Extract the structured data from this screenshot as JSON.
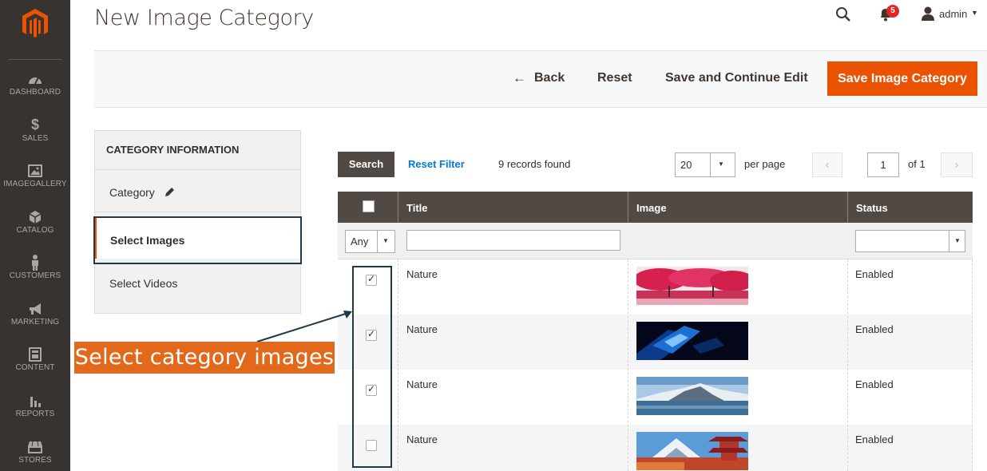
{
  "sidebar": {
    "logo": "magento-logo",
    "items": [
      {
        "label": "DASHBOARD",
        "icon": "speedometer-icon"
      },
      {
        "label": "SALES",
        "icon": "dollar-icon"
      },
      {
        "label": "IMAGEGALLERY",
        "icon": "image-icon"
      },
      {
        "label": "CATALOG",
        "icon": "cube-icon"
      },
      {
        "label": "CUSTOMERS",
        "icon": "person-icon"
      },
      {
        "label": "MARKETING",
        "icon": "megaphone-icon"
      },
      {
        "label": "CONTENT",
        "icon": "layout-icon"
      },
      {
        "label": "REPORTS",
        "icon": "bar-chart-icon"
      },
      {
        "label": "STORES",
        "icon": "store-icon"
      }
    ]
  },
  "header": {
    "title": "New Image Category",
    "notifications_count": "5",
    "user": "admin"
  },
  "actions": {
    "back_arrow": "←",
    "back": "Back",
    "reset": "Reset",
    "save_continue": "Save and Continue Edit",
    "save": "Save Image Category"
  },
  "panel": {
    "heading": "CATEGORY INFORMATION",
    "tabs": [
      {
        "label": "Category"
      },
      {
        "label": "Select Images"
      },
      {
        "label": "Select Videos"
      }
    ]
  },
  "grid": {
    "search_label": "Search",
    "reset_filter": "Reset Filter",
    "records": "9 records found",
    "per_page_value": "20",
    "per_page_label": "per page",
    "page_value": "1",
    "page_of": "of 1",
    "prev": "‹",
    "next": "›",
    "columns": [
      "Title",
      "Image",
      "Status"
    ],
    "filter_any": "Any",
    "rows": [
      {
        "checked": true,
        "title": "Nature",
        "status": "Enabled",
        "image": "pink-cherry-trees"
      },
      {
        "checked": true,
        "title": "Nature",
        "status": "Enabled",
        "image": "blue-abstract"
      },
      {
        "checked": true,
        "title": "Nature",
        "status": "Enabled",
        "image": "snowy-mountain-lake"
      },
      {
        "checked": false,
        "title": "Nature",
        "status": "Enabled",
        "image": "mount-fuji-pagoda"
      }
    ]
  },
  "annotation": {
    "text": "Select category images"
  },
  "colors": {
    "sidebar": "#373330",
    "primary": "#eb5202",
    "grid_header": "#514943",
    "annotation": "#e2681c",
    "highlight_box": "#1c3a4a",
    "link": "#007bdb"
  }
}
